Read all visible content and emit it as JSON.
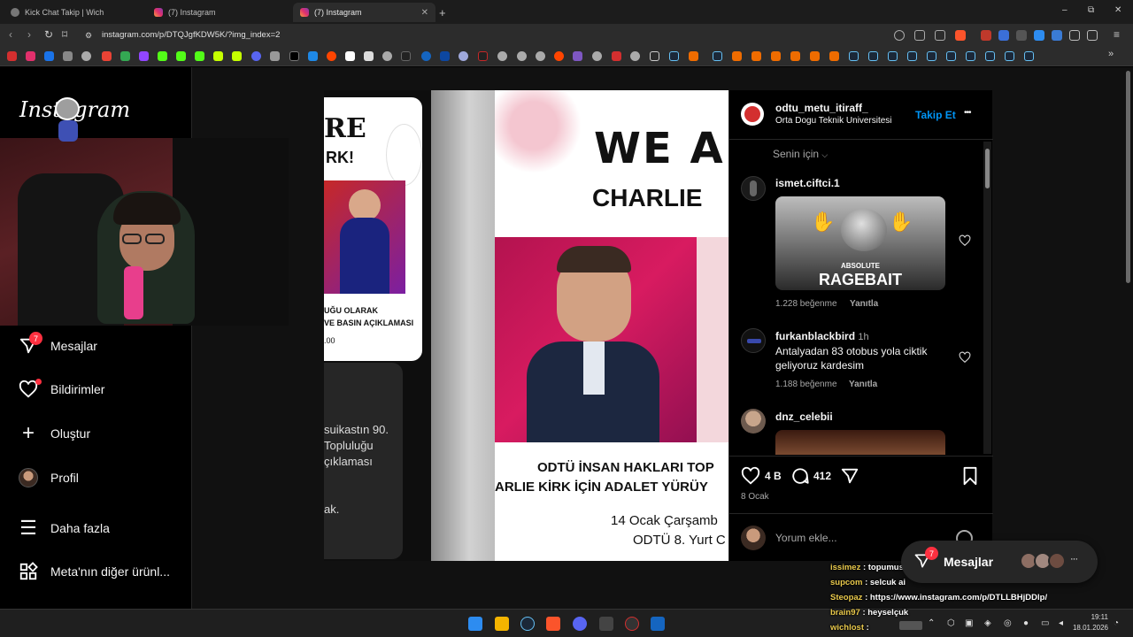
{
  "browser": {
    "tabs": [
      {
        "label": "Kick Chat Takip | Wich"
      },
      {
        "label": "(7) Instagram"
      },
      {
        "label": "(7) Instagram"
      }
    ],
    "url": "instagram.com/p/DTQJgfKDW5K/?img_index=2",
    "new_tab": "+",
    "window_controls": [
      "–",
      "⧉",
      "✕"
    ]
  },
  "instagram": {
    "logo": "Instagram",
    "nav": [
      {
        "label": "Mesajlar",
        "icon": "messenger-icon",
        "badge": "7"
      },
      {
        "label": "Bildirimler",
        "icon": "heart-icon"
      },
      {
        "label": "Oluştur",
        "icon": "plus-icon"
      },
      {
        "label": "Profil",
        "icon": "avatar"
      },
      {
        "label": "Daha fazla",
        "icon": "menu-icon"
      },
      {
        "label": "Meta'nın diğer ürünl...",
        "icon": "grid-icon"
      }
    ]
  },
  "slide_prev": {
    "heading1": "RE",
    "heading2": "RK!",
    "line1": "UĞU OLARAK",
    "line2": "VE BASIN AÇIKLAMASI",
    "line3": ".00",
    "dark_lines": [
      "suikastın 90.",
      "Topluluğu",
      "çıklaması",
      "ak."
    ]
  },
  "slide_main": {
    "title": "WE A",
    "subtitle": "CHARLIE",
    "line1": "ODTÜ İNSAN HAKLARI TOP",
    "line2": "ARLIE KİRK İÇİN ADALET YÜRÜY",
    "line3": "14 Ocak Çarşamb",
    "line4": "ODTÜ 8. Yurt C"
  },
  "post": {
    "username": "odtu_metu_itiraff_",
    "location": "Orta Dogu Teknik Universitesi",
    "follow": "Takip Et",
    "more": "•••",
    "sort": "Senin için",
    "comments": [
      {
        "user": "ismet.ciftci.1",
        "time": "",
        "text": "",
        "gif_top": "ABSOLUTE",
        "gif_main": "RAGEBAIT",
        "likes": "1.228 beğenme",
        "reply": "Yanıtla"
      },
      {
        "user": "furkanblackbird",
        "time": "1h",
        "text": "Antalyadan 83 otobus yola ciktik geliyoruz kardesim",
        "likes": "1.188 beğenme",
        "reply": "Yanıtla"
      },
      {
        "user": "dnz_celebii",
        "time": "",
        "text": ""
      }
    ],
    "like_count": "4 B",
    "comment_count": "412",
    "date": "8 Ocak",
    "comment_placeholder": "Yorum ekle..."
  },
  "messages_pill": {
    "label": "Mesajlar",
    "badge": "7",
    "more": "···"
  },
  "chat": [
    {
      "user": "issimez",
      "text": ": topumus imaiat bu imaiat"
    },
    {
      "user": "supcom",
      "text": ": selcuk ai"
    },
    {
      "user": "Steopaz",
      "text": ": https://www.instagram.com/p/DTLLBHjDDlp/"
    },
    {
      "user": "brain97",
      "text": ": heyselçuk"
    },
    {
      "user": "wichlost",
      "text": ":"
    }
  ],
  "taskbar": {
    "time": "19:11",
    "date": "18.01.2026"
  },
  "colors": {
    "accent_blue": "#0095f6",
    "badge_red": "#ff3040",
    "chat_user": "#e9c94c"
  }
}
